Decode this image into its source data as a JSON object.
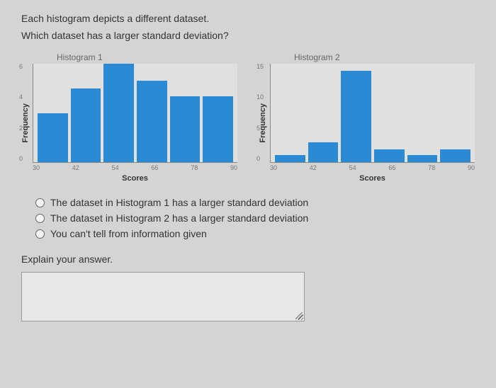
{
  "text": {
    "intro": "Each histogram depicts a different dataset.",
    "question": "Which dataset has a larger standard deviation?",
    "explain_label": "Explain your answer."
  },
  "options": [
    "The dataset in Histogram 1 has a larger standard deviation",
    "The dataset in Histogram 2 has a larger standard deviation",
    "You can't tell from information given"
  ],
  "chart_data": [
    {
      "type": "bar",
      "title": "Histogram 1",
      "xlabel": "Scores",
      "ylabel": "Frequency",
      "ylim": [
        0,
        6
      ],
      "yticks": [
        6,
        4,
        2,
        0
      ],
      "categories": [
        30,
        42,
        54,
        66,
        78,
        90
      ],
      "values": [
        3,
        4.5,
        6,
        5,
        4,
        4
      ],
      "color": "#2a8ad4"
    },
    {
      "type": "bar",
      "title": "Histogram 2",
      "xlabel": "Scores",
      "ylabel": "Frequency",
      "ylim": [
        0,
        15
      ],
      "yticks": [
        15,
        10,
        5,
        0
      ],
      "categories": [
        30,
        42,
        54,
        66,
        78,
        90
      ],
      "values": [
        1,
        3,
        14,
        2,
        1,
        2
      ],
      "color": "#2a8ad4"
    }
  ]
}
